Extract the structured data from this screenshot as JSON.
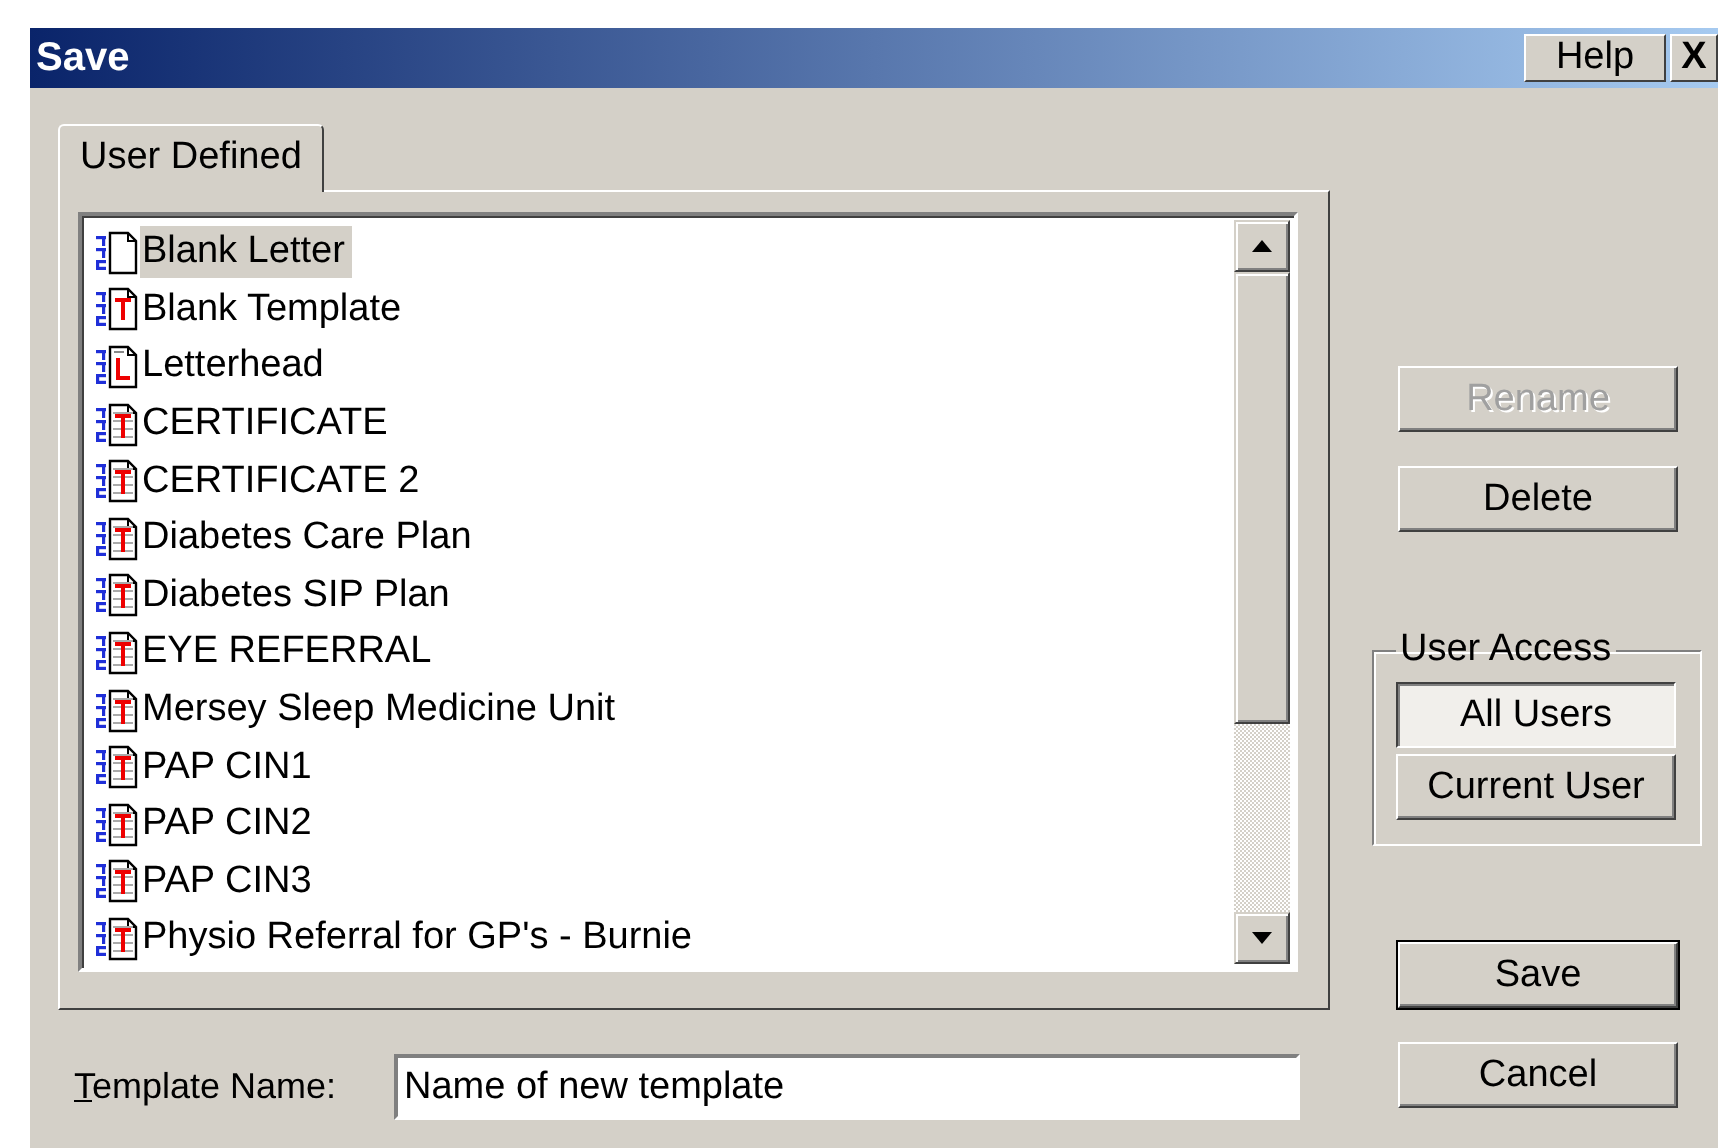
{
  "window": {
    "title": "Save",
    "buttons": [
      {
        "kind": "help",
        "label": "Help"
      },
      {
        "kind": "close",
        "label": "X"
      }
    ]
  },
  "tabs": [
    {
      "label": "User Defined",
      "selected": true
    }
  ],
  "templates": [
    {
      "name": "Blank Letter",
      "kind": "blank",
      "selected": true
    },
    {
      "name": "Blank Template",
      "kind": "template",
      "selected": false
    },
    {
      "name": "Letterhead",
      "kind": "letterhead",
      "selected": false
    },
    {
      "name": "CERTIFICATE",
      "kind": "document",
      "selected": false
    },
    {
      "name": "CERTIFICATE 2",
      "kind": "document",
      "selected": false
    },
    {
      "name": "Diabetes Care Plan",
      "kind": "document",
      "selected": false
    },
    {
      "name": "Diabetes SIP Plan",
      "kind": "document",
      "selected": false
    },
    {
      "name": "EYE REFERRAL",
      "kind": "document",
      "selected": false
    },
    {
      "name": "Mersey Sleep Medicine Unit",
      "kind": "document",
      "selected": false
    },
    {
      "name": "PAP CIN1",
      "kind": "document",
      "selected": false
    },
    {
      "name": "PAP CIN2",
      "kind": "document",
      "selected": false
    },
    {
      "name": "PAP CIN3",
      "kind": "document",
      "selected": false
    },
    {
      "name": "Physio Referral for GP's - Burnie",
      "kind": "document",
      "selected": false
    }
  ],
  "actions": [
    {
      "label": "Rename",
      "disabled": true
    },
    {
      "label": "Delete",
      "disabled": false
    }
  ],
  "user_access": {
    "title": "User Access",
    "options": [
      {
        "label": "All Users",
        "selected": true
      },
      {
        "label": "Current User",
        "selected": false
      }
    ]
  },
  "dialog_buttons": [
    {
      "label": "Save",
      "default": true
    },
    {
      "label": "Cancel",
      "default": false
    }
  ],
  "template_name": {
    "label": "Template Name:",
    "first_letter_underlined": true,
    "value": "Name of new template"
  }
}
